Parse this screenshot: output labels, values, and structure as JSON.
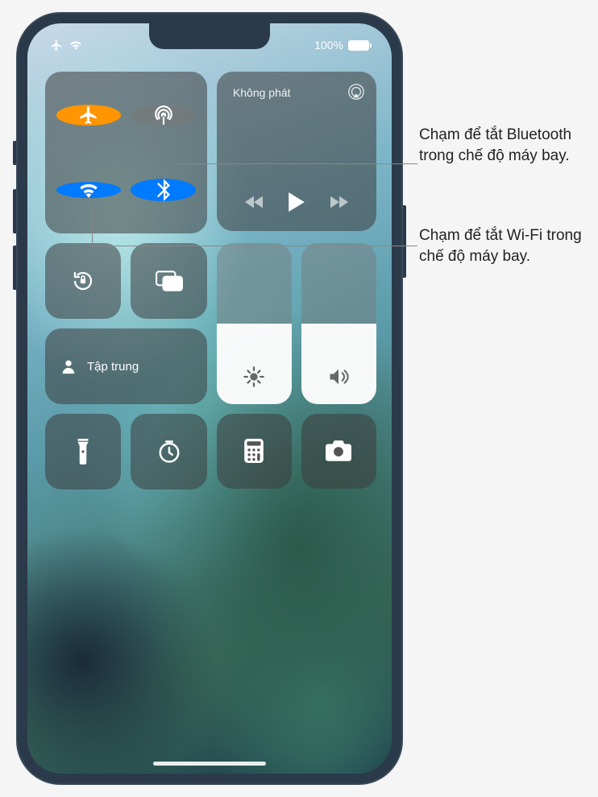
{
  "status": {
    "battery_pct": "100%"
  },
  "media": {
    "now_playing": "Không phát"
  },
  "focus": {
    "label": "Tập trung"
  },
  "icons": {
    "airplane": "airplane",
    "cellular": "cellular-antenna",
    "wifi": "wifi",
    "bluetooth": "bluetooth",
    "airplay": "airplay",
    "previous": "previous",
    "play": "play",
    "next": "next",
    "orientation_lock": "orientation-lock",
    "screen_mirror": "screen-mirror",
    "person": "person",
    "brightness": "brightness",
    "volume": "volume",
    "flashlight": "flashlight",
    "timer": "timer",
    "calculator": "calculator",
    "camera": "camera"
  },
  "callouts": {
    "bluetooth": "Chạm để tắt Bluetooth trong chế độ máy bay.",
    "wifi": "Chạm để tắt Wi-Fi trong chế độ máy bay."
  }
}
